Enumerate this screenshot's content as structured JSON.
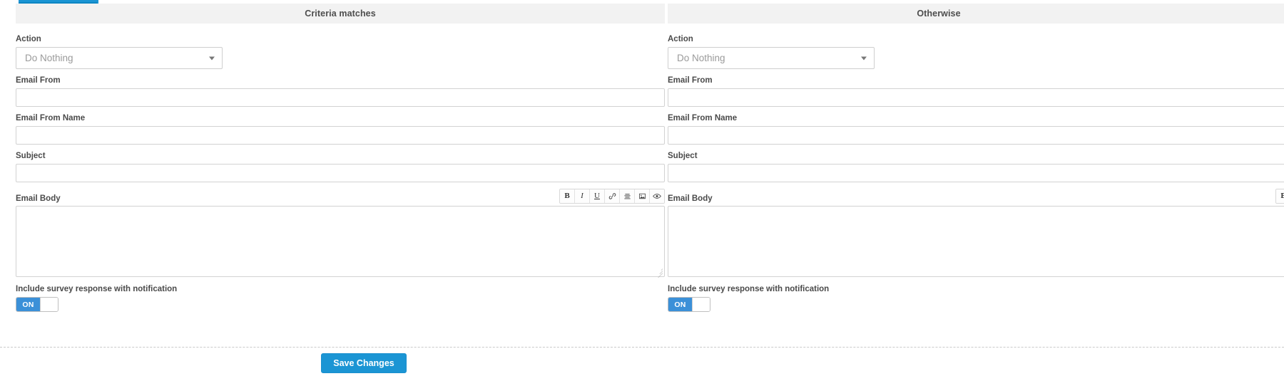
{
  "theme": {
    "accent": "#1b95d4",
    "toggle_on": "#3b90d8",
    "header_band": "#f2f2f2",
    "label_color": "#4a4a4a",
    "border": "#d2d2d2"
  },
  "panels": [
    {
      "id": "criteria-matches",
      "header": "Criteria matches",
      "fields": {
        "action": {
          "label": "Action",
          "value": "Do Nothing"
        },
        "email_from": {
          "label": "Email From",
          "value": "",
          "placeholder": ""
        },
        "email_from_name": {
          "label": "Email From Name",
          "value": "",
          "placeholder": ""
        },
        "subject": {
          "label": "Subject",
          "value": "",
          "placeholder": ""
        },
        "email_body": {
          "label": "Email Body",
          "value": "",
          "placeholder": ""
        }
      },
      "toggle": {
        "label": "Include survey response with notification",
        "state": "ON"
      }
    },
    {
      "id": "otherwise",
      "header": "Otherwise",
      "fields": {
        "action": {
          "label": "Action",
          "value": "Do Nothing"
        },
        "email_from": {
          "label": "Email From",
          "value": "",
          "placeholder": ""
        },
        "email_from_name": {
          "label": "Email From Name",
          "value": "",
          "placeholder": ""
        },
        "subject": {
          "label": "Subject",
          "value": "",
          "placeholder": ""
        },
        "email_body": {
          "label": "Email Body",
          "value": "",
          "placeholder": ""
        }
      },
      "toggle": {
        "label": "Include survey response with notification",
        "state": "ON"
      }
    }
  ],
  "editor_toolbar": {
    "buttons": [
      {
        "name": "bold-icon",
        "glyph": "B",
        "title": "Bold"
      },
      {
        "name": "italic-icon",
        "glyph": "I",
        "title": "Italic"
      },
      {
        "name": "underline-icon",
        "glyph": "U",
        "title": "Underline"
      },
      {
        "name": "link-icon",
        "glyph": "link",
        "title": "Insert Link"
      },
      {
        "name": "align-center-icon",
        "glyph": "align",
        "title": "Align"
      },
      {
        "name": "insert-image-icon",
        "glyph": "image",
        "title": "Insert Image"
      },
      {
        "name": "preview-eye-icon",
        "glyph": "eye",
        "title": "Preview"
      }
    ]
  },
  "footer": {
    "save_label": "Save Changes"
  }
}
